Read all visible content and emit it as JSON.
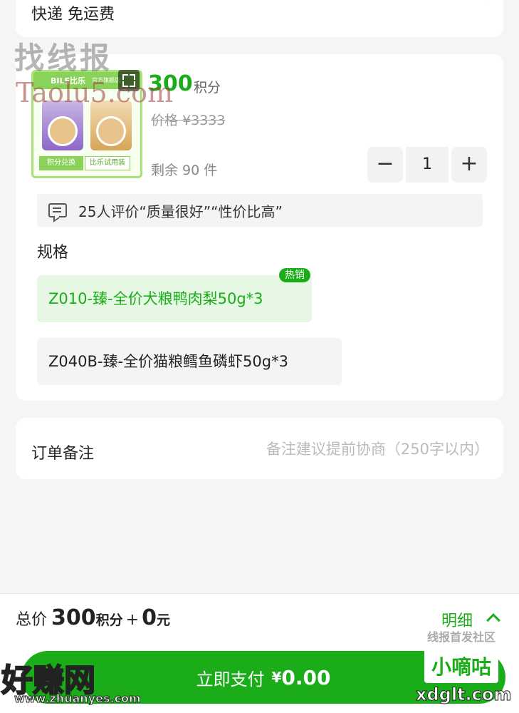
{
  "delivery": {
    "text": "快递 免运费"
  },
  "product": {
    "thumb_brand": "BILE比乐",
    "thumb_store": "官方旗舰店",
    "thumb_tag_left": "积分兑换",
    "thumb_tag_right": "比乐试用装",
    "points": "300",
    "points_unit": "积分",
    "original_price": "价格 ¥3333",
    "stock_text": "剩余 90 件",
    "quantity": "1",
    "minus_label": "−",
    "plus_label": "+"
  },
  "review": {
    "text": "25人评价“质量很好”“性价比高”"
  },
  "spec": {
    "label": "规格",
    "hot_badge": "热销",
    "options": [
      {
        "label": "Z010-臻-全价犬粮鸭肉梨50g*3",
        "selected": true
      },
      {
        "label": "Z040B-臻-全价猫粮鳕鱼磷虾50g*3",
        "selected": false
      }
    ]
  },
  "notes": {
    "label": "订单备注",
    "placeholder": "备注建议提前协商（250字以内）",
    "value": ""
  },
  "footer": {
    "total_label": "总价",
    "total_points": "300",
    "total_points_unit": "积分",
    "plus": "+",
    "total_cash": "0",
    "total_cash_unit": "元",
    "detail_label": "明细",
    "pay_label": "立即支付",
    "pay_currency": "¥",
    "pay_amount": "0.00"
  },
  "watermarks": {
    "w1": "找线报",
    "w2": "Taolu5.com",
    "w3": "线报首发社区",
    "w4": "好赚网",
    "w5": "www.zhuanyes.com",
    "w6": "小嘀咕",
    "w7": "xdglt.com"
  },
  "colors": {
    "accent": "#1aad19",
    "accent_light": "#e6f7e4",
    "background": "#f5f5f5"
  }
}
